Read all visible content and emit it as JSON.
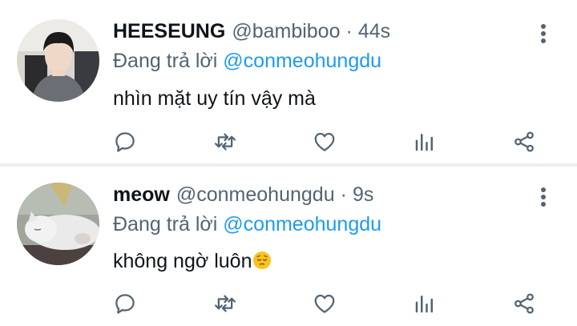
{
  "tweets": [
    {
      "display_name": "HEESEUNG",
      "handle": "@bambiboo",
      "separator": "·",
      "time": "44s",
      "reply_prefix": "Đang trả lời",
      "reply_to": "@conmeohungdu",
      "text": "nhìn mặt uy tín vậy mà",
      "avatar": "person-avatar",
      "actions": [
        "reply-icon",
        "retweet-icon",
        "like-icon",
        "analytics-icon",
        "share-icon"
      ]
    },
    {
      "display_name": "meow",
      "handle": "@conmeohungdu",
      "separator": "·",
      "time": "9s",
      "reply_prefix": "Đang trả lời",
      "reply_to": "@conmeohungdu",
      "text": "không ngờ luôn",
      "emoji": "pensive-face-emoji",
      "avatar": "cat-avatar",
      "actions": [
        "reply-icon",
        "retweet-icon",
        "like-icon",
        "analytics-icon",
        "share-icon"
      ]
    }
  ],
  "colors": {
    "text": "#0f1419",
    "secondary": "#536471",
    "link": "#1d9bf0",
    "divider": "#eceff1"
  }
}
